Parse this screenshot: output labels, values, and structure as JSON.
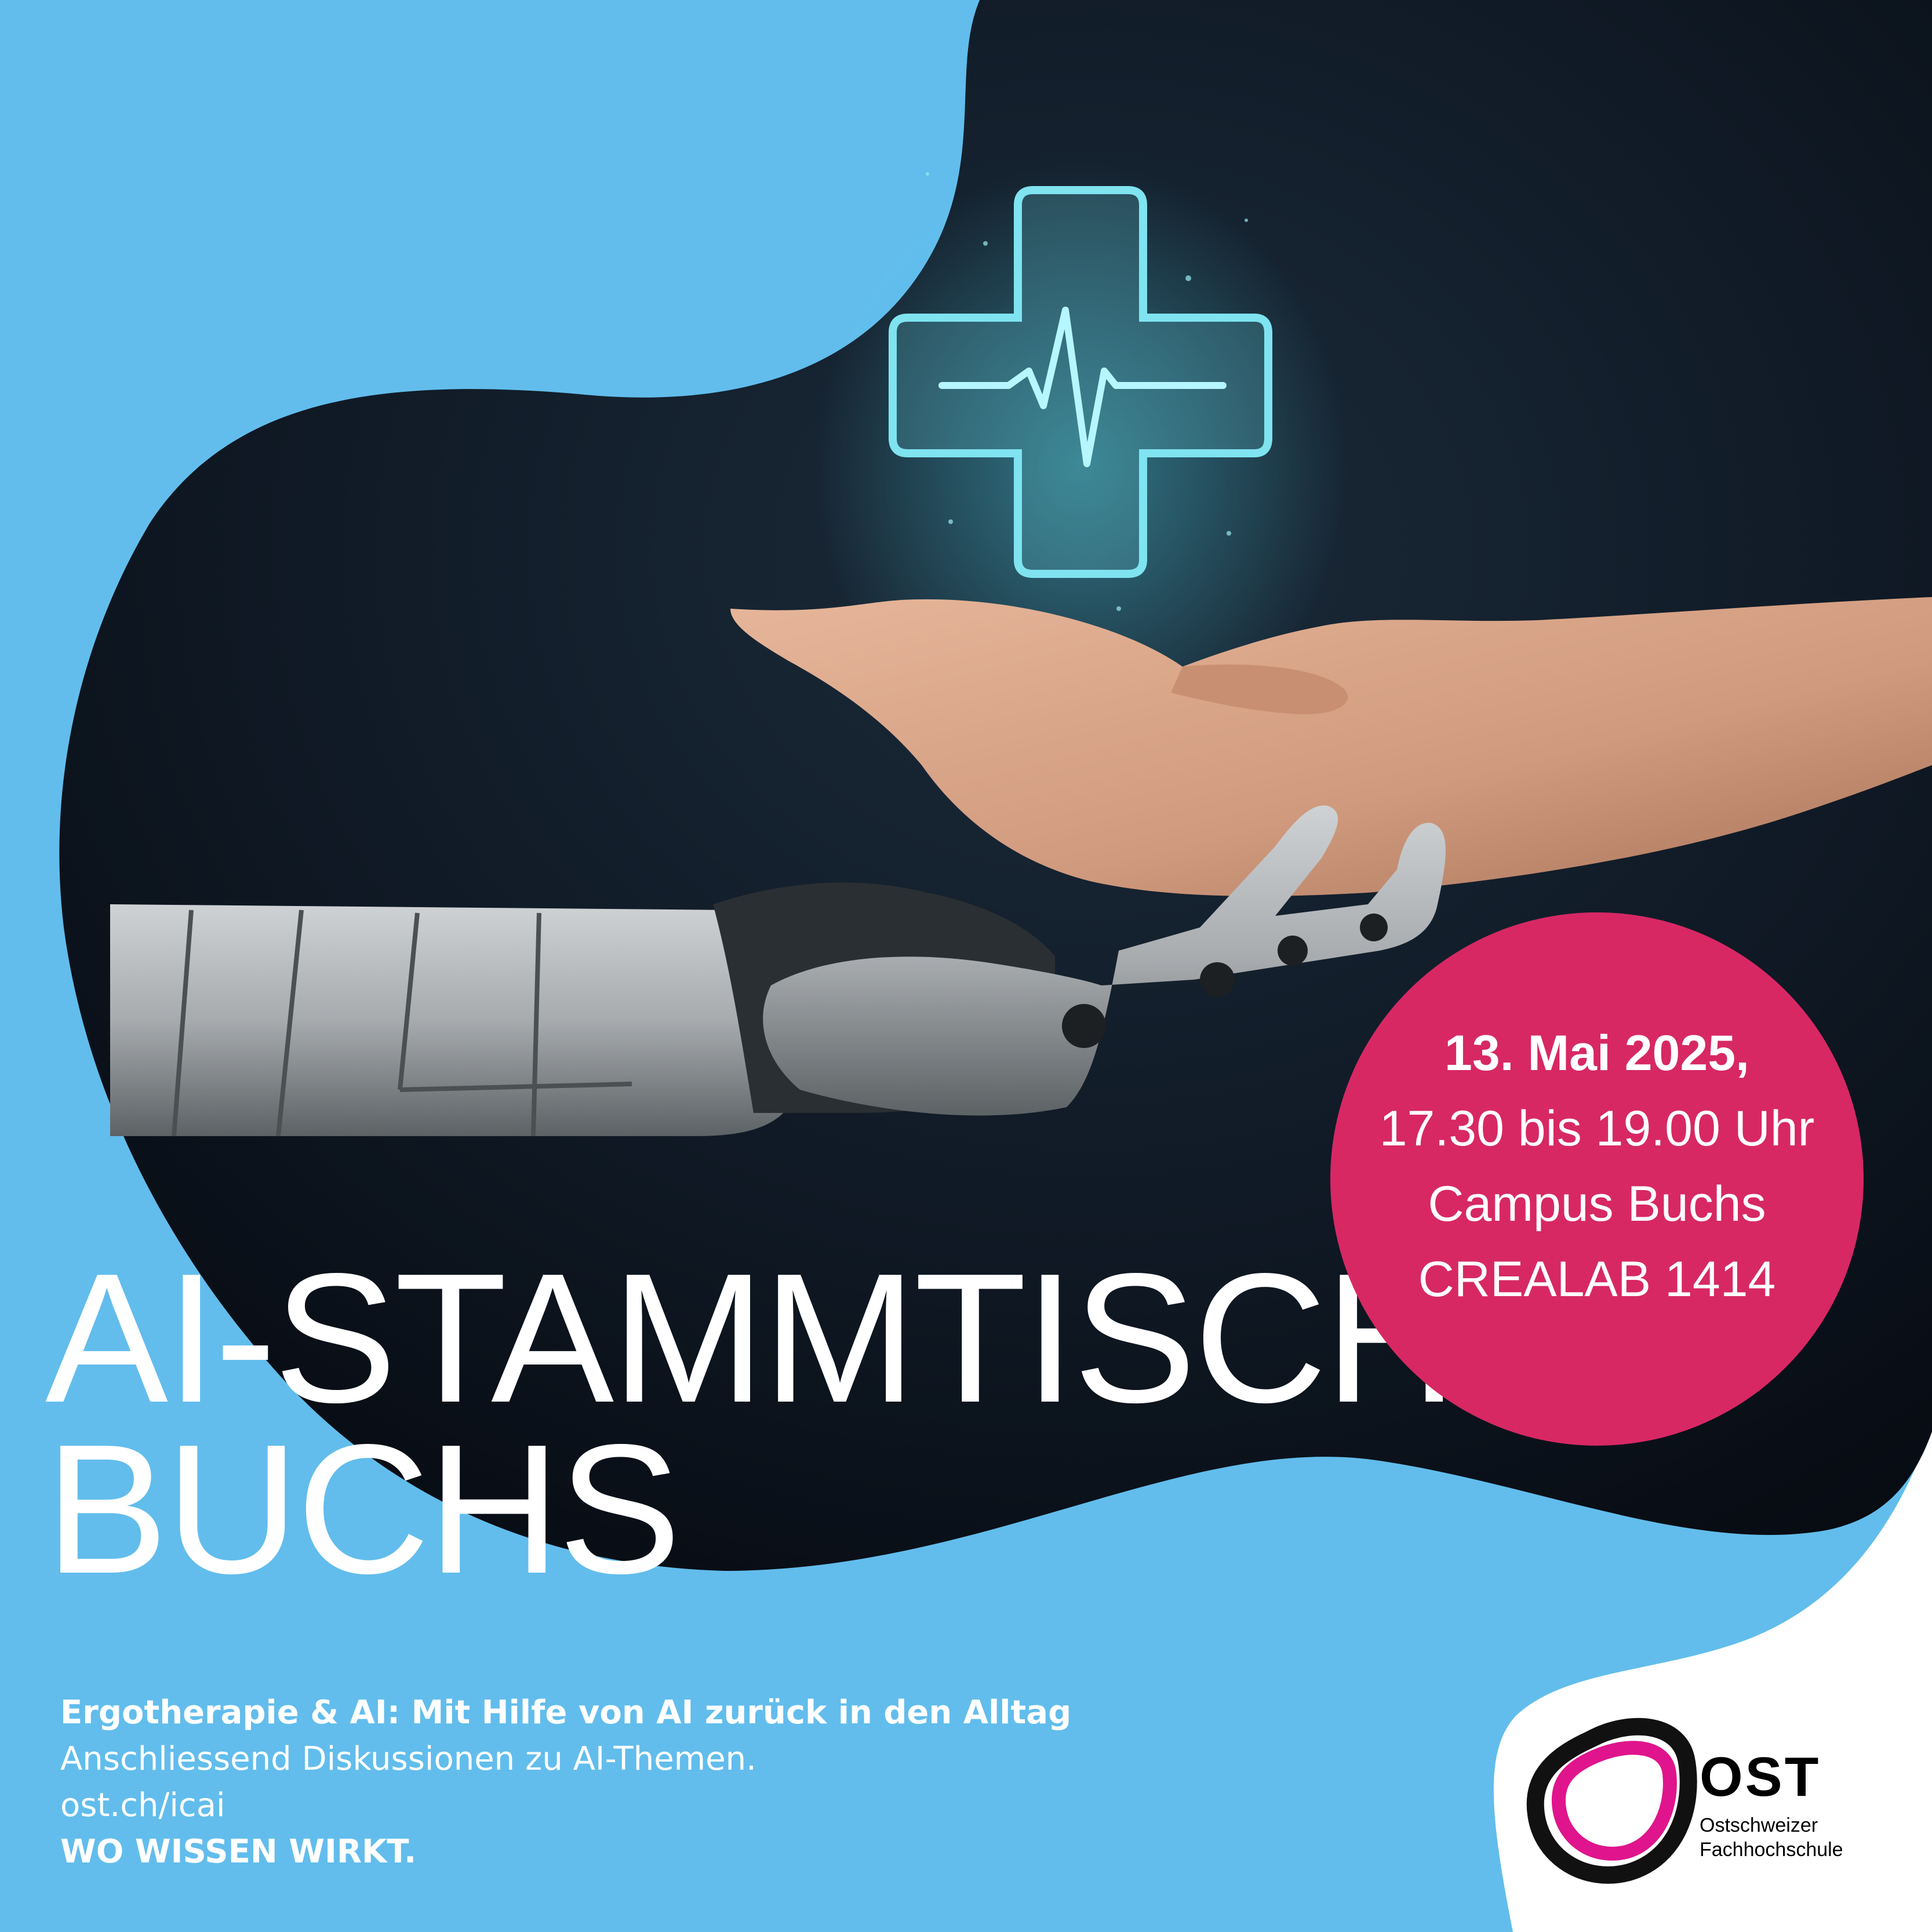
{
  "poster": {
    "title_line_1": "AI-STAMMTISCH",
    "title_line_2": "BUCHS"
  },
  "event": {
    "date": "13. Mai 2025,",
    "time": "17.30 bis 19.00 Uhr",
    "campus": "Campus Buchs",
    "room": "CREALAB 1414"
  },
  "footer": {
    "topic": "Ergotherapie & AI: Mit Hilfe von AI zurück in den Alltag",
    "subline": "Anschliessend Diskussionen zu AI-Themen.",
    "url": "ost.ch/icai",
    "slogan": "WO WISSEN WIRKT."
  },
  "logo": {
    "name": "OST",
    "subtitle_line_1": "Ostschweizer",
    "subtitle_line_2": "Fachhochschule"
  },
  "colors": {
    "background_blue": "#62bdec",
    "accent_pink": "#d72864",
    "photo_dark": "#0d1620",
    "text_white": "#ffffff"
  },
  "icons": {
    "medical_cross": "medical-cross-icon",
    "heartbeat": "heartbeat-line-icon",
    "logo_ring": "ost-logo-ring-icon"
  }
}
